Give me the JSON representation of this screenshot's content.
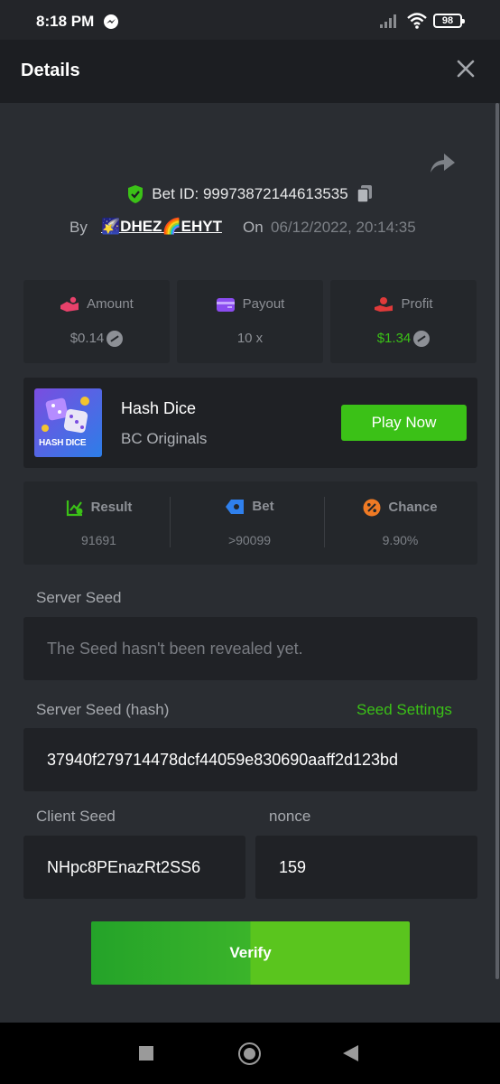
{
  "status_bar": {
    "time": "8:18 PM",
    "battery": "98"
  },
  "header": {
    "title": "Details"
  },
  "bet": {
    "id_text": "Bet ID: 99973872144613535",
    "by_label": "By",
    "user": "🌠DHEZ🌈EHYT",
    "on_label": "On",
    "date": "06/12/2022, 20:14:35"
  },
  "stats": [
    {
      "label": "Amount",
      "value": "$0.14",
      "value_color": "#8d9096",
      "icon": "hand-coin-icon"
    },
    {
      "label": "Payout",
      "value": "10 x",
      "value_color": "#8d9096",
      "icon": "wallet-icon"
    },
    {
      "label": "Profit",
      "value": "$1.34",
      "value_color": "#3bc117",
      "icon": "profit-icon"
    }
  ],
  "game": {
    "thumb_label": "HASH DICE",
    "name": "Hash Dice",
    "provider": "BC Originals",
    "play_label": "Play Now"
  },
  "result": [
    {
      "label": "Result",
      "value": "91691",
      "icon": "chart-check-icon"
    },
    {
      "label": "Bet",
      "value": ">90099",
      "icon": "ticket-icon"
    },
    {
      "label": "Chance",
      "value": "9.90%",
      "icon": "percent-icon"
    }
  ],
  "seeds": {
    "server_seed_label": "Server Seed",
    "server_seed_value": "The Seed hasn't been revealed yet.",
    "server_hash_label": "Server Seed (hash)",
    "seed_settings_label": "Seed Settings",
    "server_hash_value": "37940f279714478dcf44059e830690aaff2d123bd",
    "client_seed_label": "Client Seed",
    "client_seed_value": "NHpc8PEnazRt2SS6",
    "nonce_label": "nonce",
    "nonce_value": "159"
  },
  "verify_label": "Verify",
  "colors": {
    "accent_green": "#3bc117",
    "panel": "#2a2d32",
    "card": "#24272b"
  }
}
